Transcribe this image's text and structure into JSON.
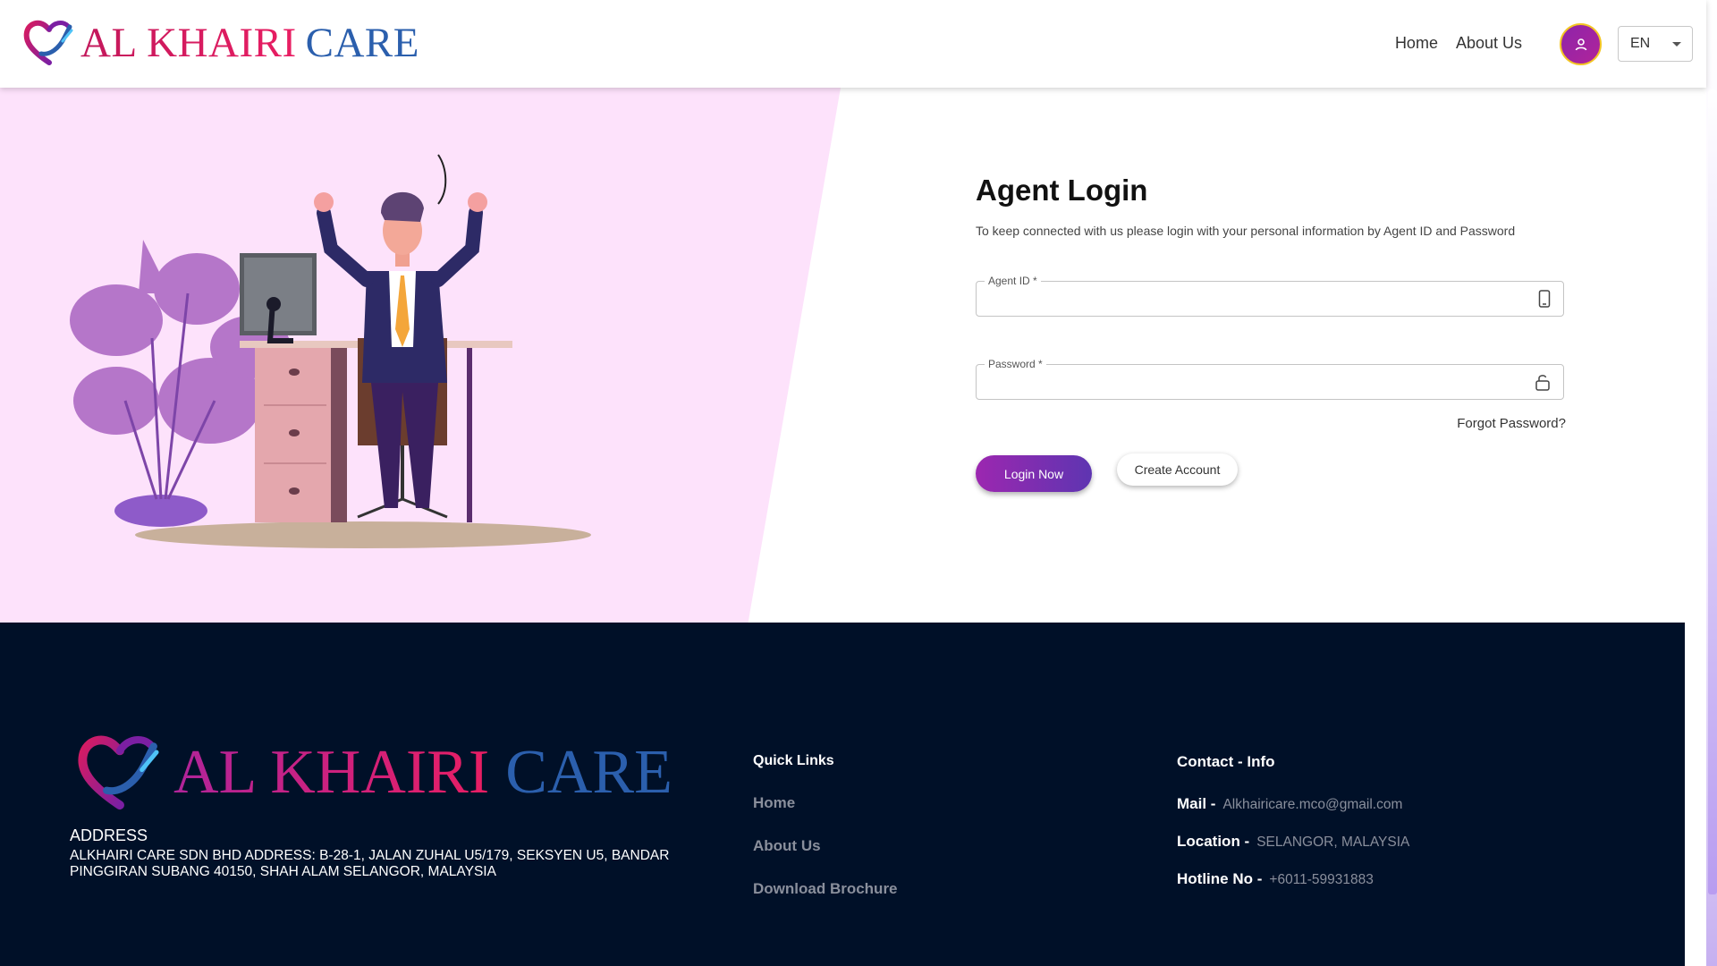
{
  "header": {
    "brand_part1": "AL KHAIRI",
    "brand_part2": "CARE",
    "nav": [
      {
        "label": "Home"
      },
      {
        "label": "About Us"
      }
    ],
    "language": "EN"
  },
  "login": {
    "title": "Agent Login",
    "subtitle": "To keep connected with us please login with your personal information by Agent ID and Password",
    "agent_id_label": "Agent ID *",
    "agent_id_value": "",
    "password_label": "Password *",
    "password_value": "",
    "forgot": "Forgot Password?",
    "login_button": "Login Now",
    "create_button": "Create Account"
  },
  "footer": {
    "brand_part1": "AL KHAIRI",
    "brand_part2": "CARE",
    "address_title": "ADDRESS",
    "address_text": "ALKHAIRI CARE SDN BHD ADDRESS: B-28-1, JALAN ZUHAL U5/179, SEKSYEN U5, BANDAR PINGGIRAN SUBANG 40150, SHAH ALAM SELANGOR, MALAYSIA",
    "quick_links_title": "Quick Links",
    "quick_links": [
      {
        "label": "Home"
      },
      {
        "label": "About Us"
      },
      {
        "label": "Download Brochure"
      }
    ],
    "contact_title": "Contact - Info",
    "contact": [
      {
        "key": "Mail -",
        "value": "Alkhairicare.mco@gmail.com"
      },
      {
        "key": "Location -",
        "value": "SELANGOR, MALAYSIA"
      },
      {
        "key": "Hotline No -",
        "value": "+6011-59931883"
      }
    ]
  },
  "colors": {
    "accent_purple": "#9c27b0",
    "brand_pink": "#e91e63",
    "brand_blue": "#2b5fad",
    "footer_bg": "#001028",
    "hero_pink": "#fde2fb"
  }
}
